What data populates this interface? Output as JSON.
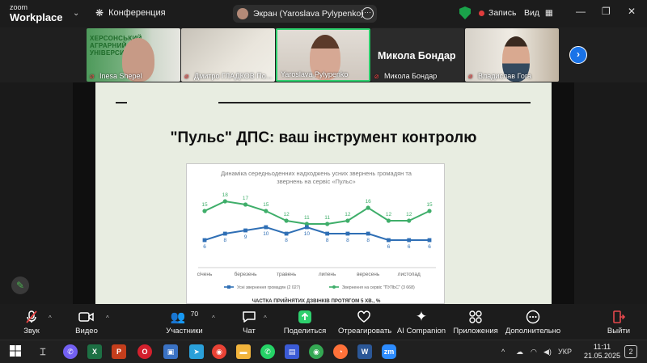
{
  "app": {
    "logo_line1": "zoom",
    "logo_line2": "Workplace"
  },
  "topbar": {
    "meeting_label": "Конференция",
    "share_label": "Экран (Yaroslava Pylypenko)",
    "record_label": "Запись",
    "view_label": "Вид"
  },
  "participants": [
    {
      "name": "Inesa Shepel",
      "banner": "ХЕРСОНСЬКИЙ АГРАРНИЙ УНІВЕРСИТЕТ"
    },
    {
      "name": "Дмитро ГЛАДКОВ По..."
    },
    {
      "name": "Yaroslava Pylypenko"
    },
    {
      "name": "Микола Бондар",
      "big_name": "Микола Бондар"
    },
    {
      "name": "Владислав Гога"
    }
  ],
  "slide": {
    "title": "\"Пульс\" ДПС: ваш інструмент контролю",
    "footer": "ЧАСТКА ПРИЙНЯТИХ ДЗВІНКІВ ПРОТЯГОМ 5 ХВ., %"
  },
  "chart_data": {
    "type": "line",
    "title": "Динаміка середньоденних надходжень усних звернень громадян та звернень на сервіс «Пульс»",
    "categories": [
      "січень",
      "",
      "березень",
      "",
      "травень",
      "",
      "липень",
      "",
      "вересень",
      "",
      "листопад",
      ""
    ],
    "x_tick_labels": [
      "січень",
      "березень",
      "травень",
      "липень",
      "вересень",
      "листопад"
    ],
    "series": [
      {
        "name": "Звернення на сервіс \"ПУЛЬС\" (3 668)",
        "color": "#3fae6a",
        "values": [
          15,
          18,
          17,
          15,
          12,
          11,
          11,
          12,
          16,
          12,
          12,
          15
        ]
      },
      {
        "name": "Усні звернення громадян (2 027)",
        "color": "#2f6fb5",
        "values": [
          6,
          8,
          9,
          10,
          8,
          10,
          8,
          8,
          8,
          6,
          6,
          6
        ]
      }
    ],
    "ylim": [
      0,
      22
    ],
    "grid": false,
    "legend": "bottom"
  },
  "toolbar": [
    {
      "id": "audio",
      "label": "Звук"
    },
    {
      "id": "video",
      "label": "Видео"
    },
    {
      "id": "participants",
      "label": "Участники",
      "count": "70"
    },
    {
      "id": "chat",
      "label": "Чат"
    },
    {
      "id": "share",
      "label": "Поделиться"
    },
    {
      "id": "react",
      "label": "Отреагировать"
    },
    {
      "id": "ai",
      "label": "AI Companion"
    },
    {
      "id": "apps",
      "label": "Приложения"
    },
    {
      "id": "more",
      "label": "Дополнительно"
    },
    {
      "id": "leave",
      "label": "Выйти"
    }
  ],
  "taskbar": {
    "apps": [
      "W",
      "X",
      "P",
      "O",
      "zm"
    ],
    "language": "УКР",
    "time": "11:11",
    "date": "21.05.2025",
    "notifications": "2"
  },
  "colors": {
    "accent_green": "#2ed06e",
    "record_red": "#e03c3c",
    "zoom_blue": "#1a73e8",
    "leave_red": "#e5484d"
  }
}
